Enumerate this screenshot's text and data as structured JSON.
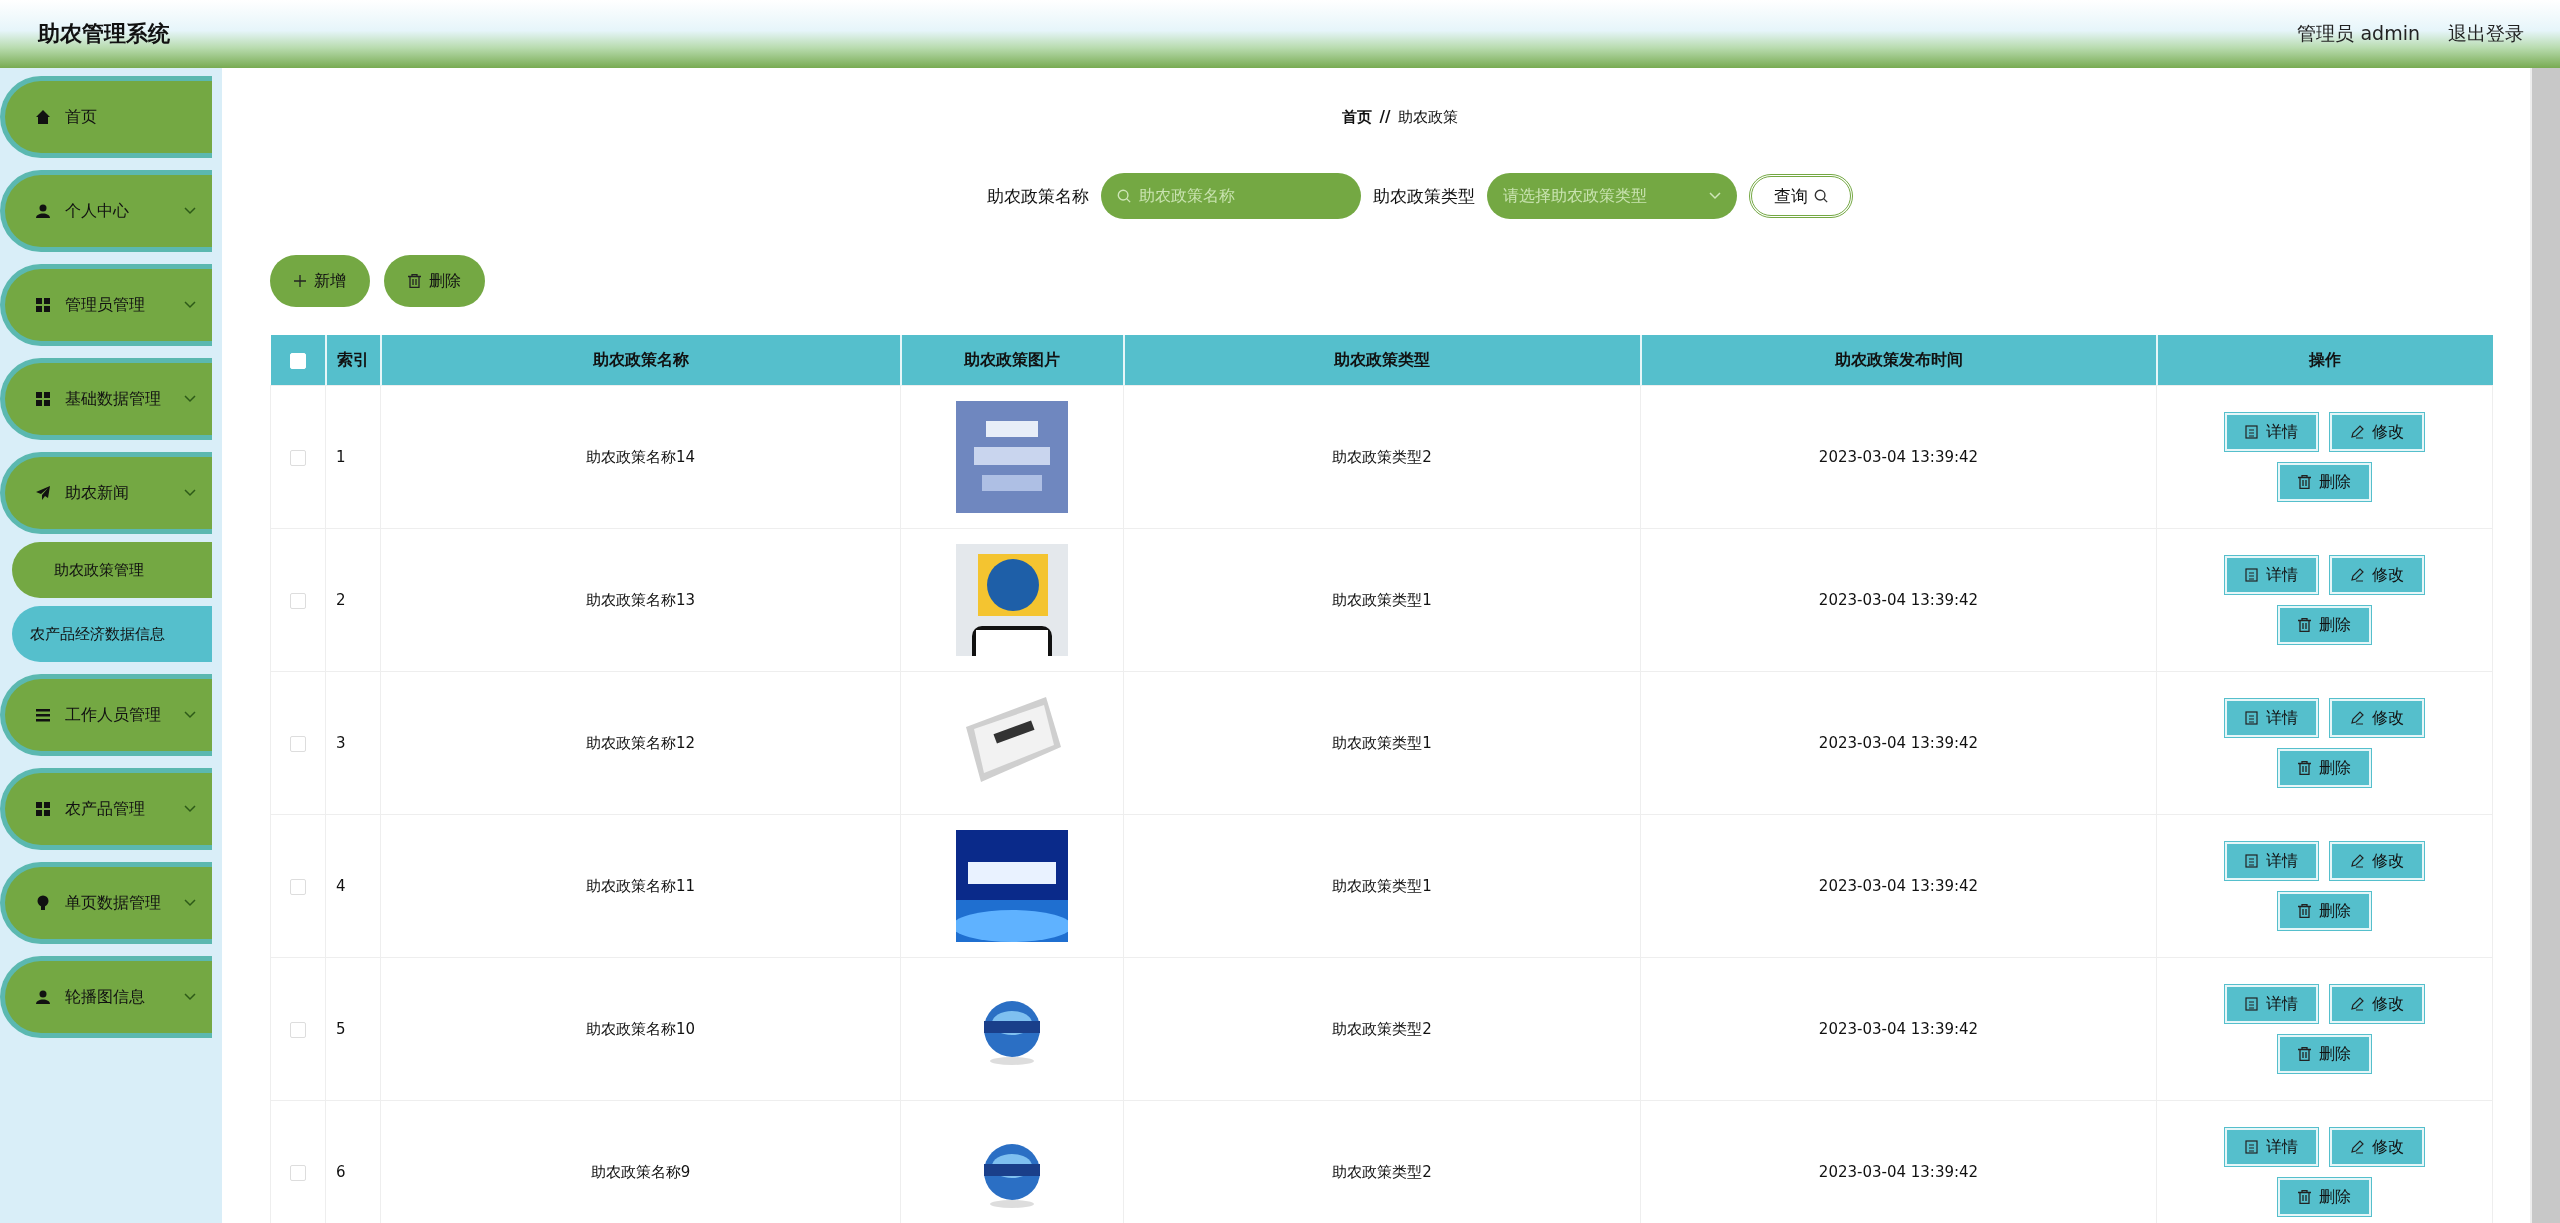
{
  "header": {
    "title": "助农管理系统",
    "user": "管理员 admin",
    "logout": "退出登录"
  },
  "sidebar": {
    "items": [
      {
        "label": "首页",
        "expandable": false
      },
      {
        "label": "个人中心",
        "expandable": true
      },
      {
        "label": "管理员管理",
        "expandable": true
      },
      {
        "label": "基础数据管理",
        "expandable": true
      },
      {
        "label": "助农新闻",
        "expandable": true,
        "children": [
          {
            "label": "助农政策管理",
            "highlighted": false
          },
          {
            "label": "农产品经济数据信息",
            "highlighted": true
          }
        ]
      },
      {
        "label": "工作人员管理",
        "expandable": true
      },
      {
        "label": "农产品管理",
        "expandable": true
      },
      {
        "label": "单页数据管理",
        "expandable": true
      },
      {
        "label": "轮播图信息",
        "expandable": true
      }
    ]
  },
  "breadcrumb": [
    "首页",
    "//",
    "助农政策"
  ],
  "search": {
    "name_label": "助农政策名称",
    "name_placeholder": "助农政策名称",
    "type_label": "助农政策类型",
    "type_placeholder": "请选择助农政策类型",
    "button": "查询"
  },
  "actions": [
    "新增",
    "删除"
  ],
  "table": {
    "header_checked": false,
    "columns": [
      "索引",
      "助农政策名称",
      "助农政策图片",
      "助农政策类型",
      "助农政策发布时间",
      "操作"
    ],
    "rows": [
      {
        "checked": false,
        "index": "1",
        "name": "助农政策名称14",
        "type": "助农政策类型2",
        "time": "2023-03-04 13:39:42",
        "buttons": [
          "详情",
          "修改",
          "删除"
        ]
      },
      {
        "checked": false,
        "index": "2",
        "name": "助农政策名称13",
        "type": "助农政策类型1",
        "time": "2023-03-04 13:39:42",
        "buttons": [
          "详情",
          "修改",
          "删除"
        ]
      },
      {
        "checked": false,
        "index": "3",
        "name": "助农政策名称12",
        "type": "助农政策类型1",
        "time": "2023-03-04 13:39:42",
        "buttons": [
          "详情",
          "修改",
          "删除"
        ]
      },
      {
        "checked": false,
        "index": "4",
        "name": "助农政策名称11",
        "type": "助农政策类型1",
        "time": "2023-03-04 13:39:42",
        "buttons": [
          "详情",
          "修改",
          "删除"
        ]
      },
      {
        "checked": false,
        "index": "5",
        "name": "助农政策名称10",
        "type": "助农政策类型2",
        "time": "2023-03-04 13:39:42",
        "buttons": [
          "详情",
          "修改",
          "删除"
        ]
      },
      {
        "checked": false,
        "index": "6",
        "name": "助农政策名称9",
        "type": "助农政策类型2",
        "time": "2023-03-04 13:39:42",
        "buttons": [
          "详情",
          "修改",
          "删除"
        ]
      }
    ]
  }
}
